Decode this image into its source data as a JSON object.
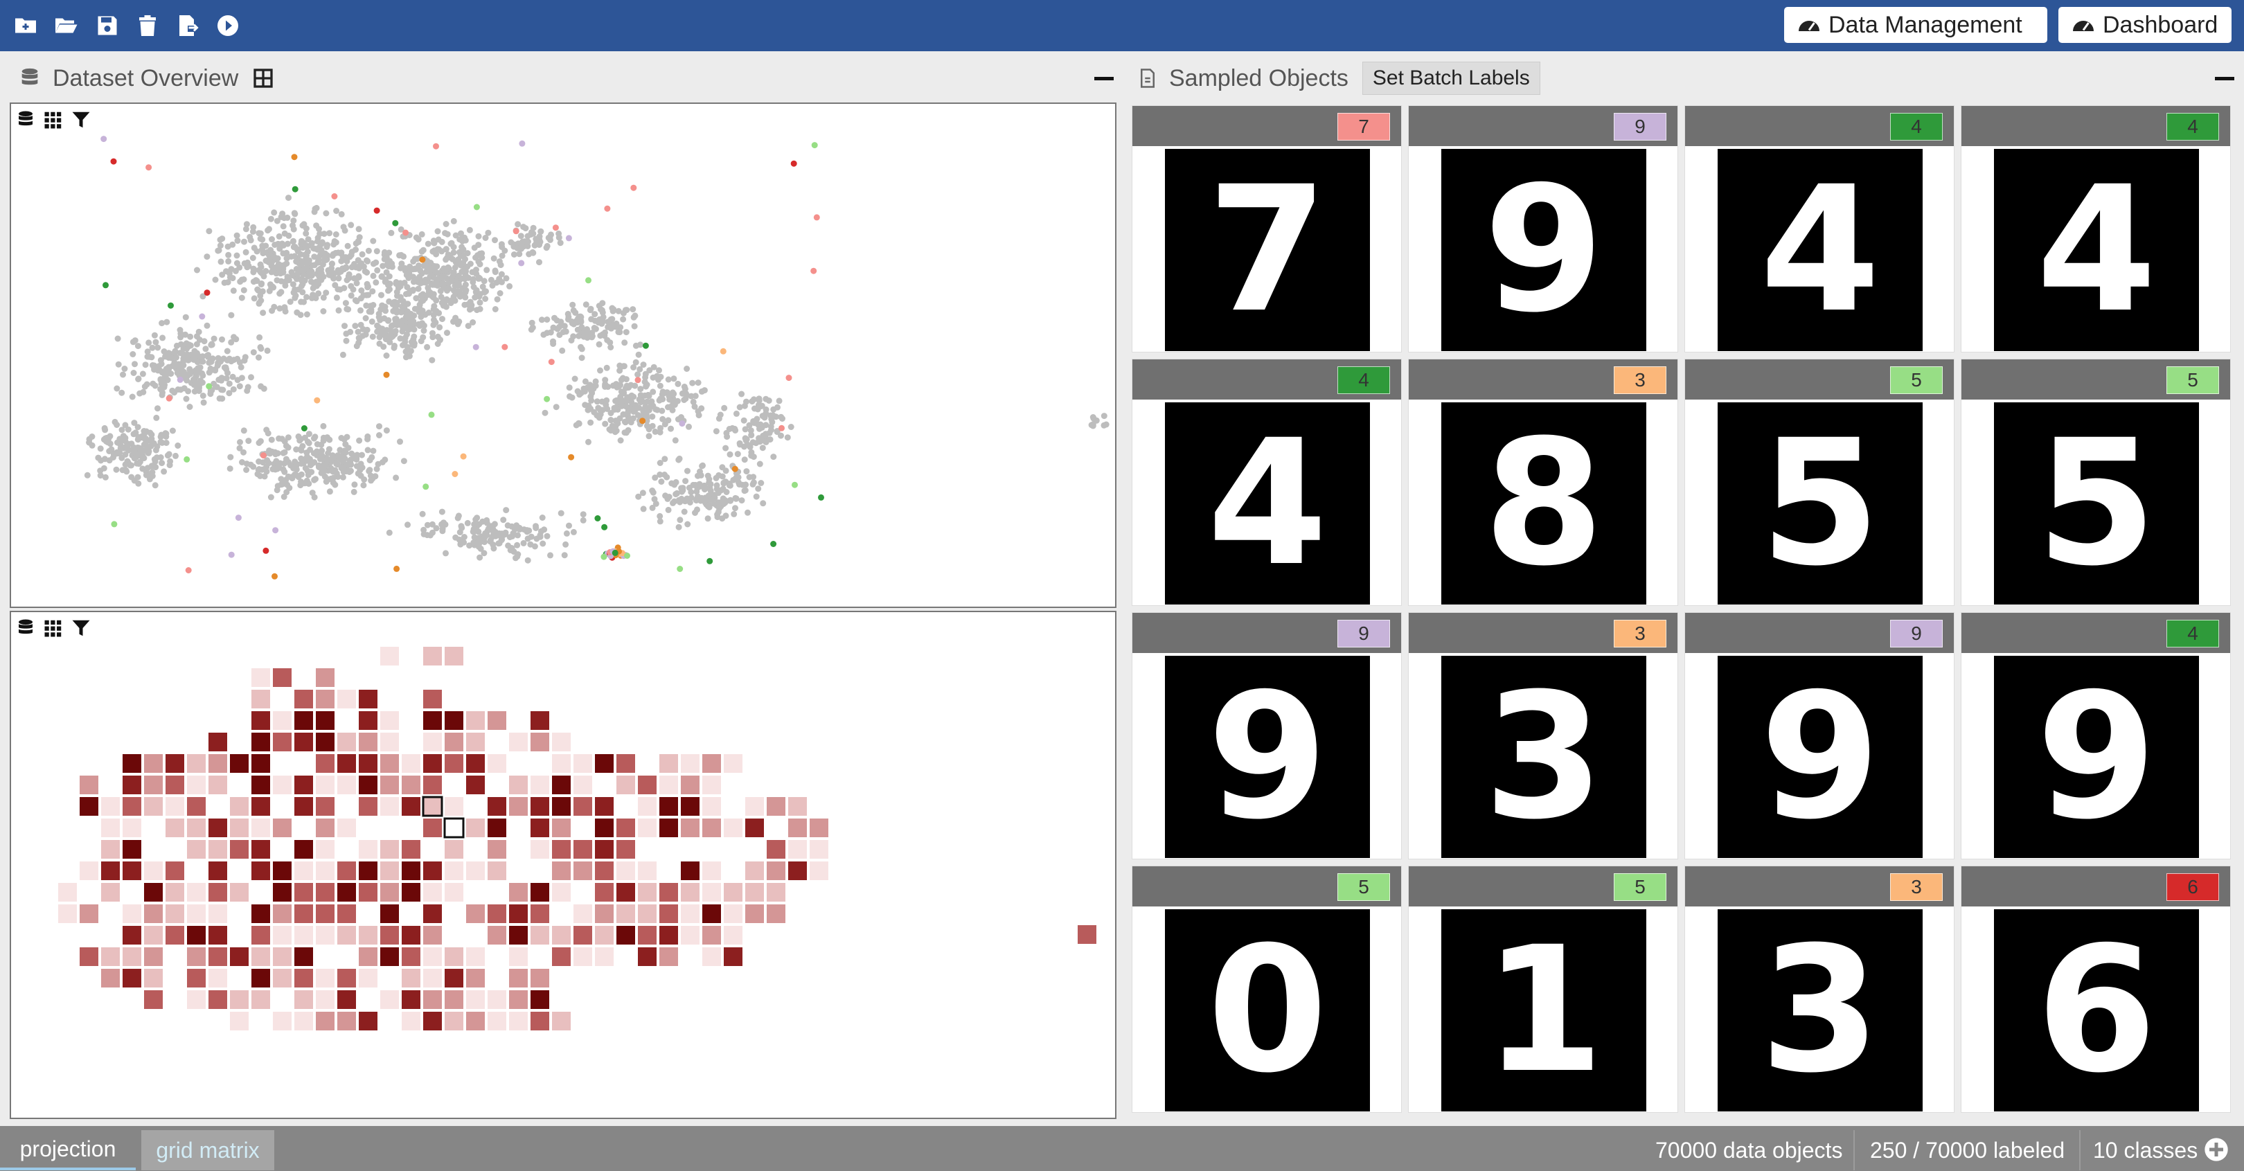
{
  "toolbar": {
    "icons": [
      "new-folder-icon",
      "open-folder-icon",
      "save-icon",
      "trash-icon",
      "export-icon",
      "play-icon"
    ],
    "data_management_label": "Data Management",
    "dashboard_label": "Dashboard"
  },
  "left_panel": {
    "title": "Dataset Overview",
    "views": [
      {
        "type": "projection",
        "tools": [
          "database-icon",
          "grid-icon",
          "filter-icon"
        ]
      },
      {
        "type": "grid matrix",
        "tools": [
          "database-icon",
          "grid-icon",
          "filter-icon"
        ]
      }
    ]
  },
  "right_panel": {
    "title": "Sampled Objects",
    "batch_button": "Set Batch Labels",
    "samples": [
      {
        "label": "7",
        "digit": "7",
        "badge_color": "#f4908c"
      },
      {
        "label": "9",
        "digit": "9",
        "badge_color": "#c7b3d9"
      },
      {
        "label": "4",
        "digit": "4",
        "badge_color": "#2f9a3a"
      },
      {
        "label": "4",
        "digit": "4",
        "badge_color": "#2f9a3a"
      },
      {
        "label": "4",
        "digit": "4",
        "badge_color": "#2f9a3a"
      },
      {
        "label": "3",
        "digit": "8",
        "badge_color": "#fbb77a"
      },
      {
        "label": "5",
        "digit": "5",
        "badge_color": "#97de85"
      },
      {
        "label": "5",
        "digit": "5",
        "badge_color": "#97de85"
      },
      {
        "label": "9",
        "digit": "9",
        "badge_color": "#c7b3d9"
      },
      {
        "label": "3",
        "digit": "3",
        "badge_color": "#fbb77a"
      },
      {
        "label": "9",
        "digit": "9",
        "badge_color": "#c7b3d9"
      },
      {
        "label": "4",
        "digit": "9",
        "badge_color": "#2f9a3a"
      },
      {
        "label": "5",
        "digit": "0",
        "badge_color": "#97de85"
      },
      {
        "label": "5",
        "digit": "1",
        "badge_color": "#97de85"
      },
      {
        "label": "3",
        "digit": "3",
        "badge_color": "#fbb77a"
      },
      {
        "label": "6",
        "digit": "6",
        "badge_color": "#d62a2a"
      }
    ]
  },
  "status": {
    "tabs": [
      "projection",
      "grid matrix"
    ],
    "active_tab": "grid matrix",
    "objects": "70000 data objects",
    "labeled": "250 / 70000 labeled",
    "classes": "10 classes"
  },
  "colors": {
    "topbar": "#2d5597",
    "projection_point": "#bdbdbd",
    "grid_heat": [
      "#f7e3e3",
      "#e8bfbf",
      "#d49696",
      "#b85b5b",
      "#8c1f1f",
      "#6b0808"
    ]
  }
}
